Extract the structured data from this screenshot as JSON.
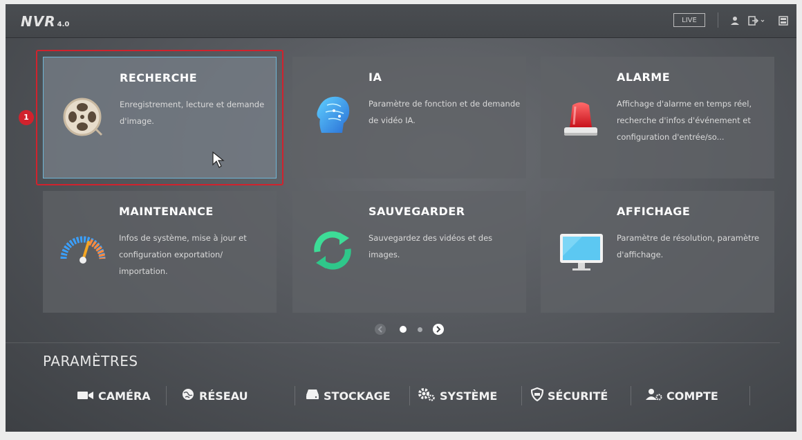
{
  "header": {
    "logo_text": "NVR",
    "logo_version": "4.0",
    "live_label": "LIVE"
  },
  "tiles": [
    {
      "title": "RECHERCHE",
      "description": "Enregistrement, lecture et demande d'image.",
      "icon": "film-reel-icon"
    },
    {
      "title": "IA",
      "description": "Paramètre de fonction et de demande de vidéo IA.",
      "icon": "ai-head-icon"
    },
    {
      "title": "ALARME",
      "description": "Affichage d'alarme en temps réel, recherche d'infos d'événement et configuration d'entrée/so...",
      "icon": "alarm-siren-icon"
    },
    {
      "title": "MAINTENANCE",
      "description": "Infos de système, mise à jour et configuration exportation/ importation.",
      "icon": "gauge-icon"
    },
    {
      "title": "SAUVEGARDER",
      "description": "Sauvegardez des vidéos et des images.",
      "icon": "sync-arrows-icon"
    },
    {
      "title": "AFFICHAGE",
      "description": "Paramètre de résolution, paramètre d'affichage.",
      "icon": "monitor-icon"
    }
  ],
  "annotation": {
    "badge": "1"
  },
  "pager": {
    "pages": 2,
    "current_page": 1
  },
  "settings": {
    "title": "PARAMÈTRES",
    "items": [
      {
        "label": "CAMÉRA",
        "icon": "camera-icon"
      },
      {
        "label": "RÉSEAU",
        "icon": "network-globe-icon"
      },
      {
        "label": "STOCKAGE",
        "icon": "hard-drive-icon"
      },
      {
        "label": "SYSTÈME",
        "icon": "gears-icon"
      },
      {
        "label": "SÉCURITÉ",
        "icon": "shield-icon"
      },
      {
        "label": "COMPTE",
        "icon": "account-icon"
      }
    ]
  },
  "colors": {
    "highlight": "#d1222d",
    "selected_border": "#6fb6d6",
    "sync_green": "#3ddc97"
  }
}
